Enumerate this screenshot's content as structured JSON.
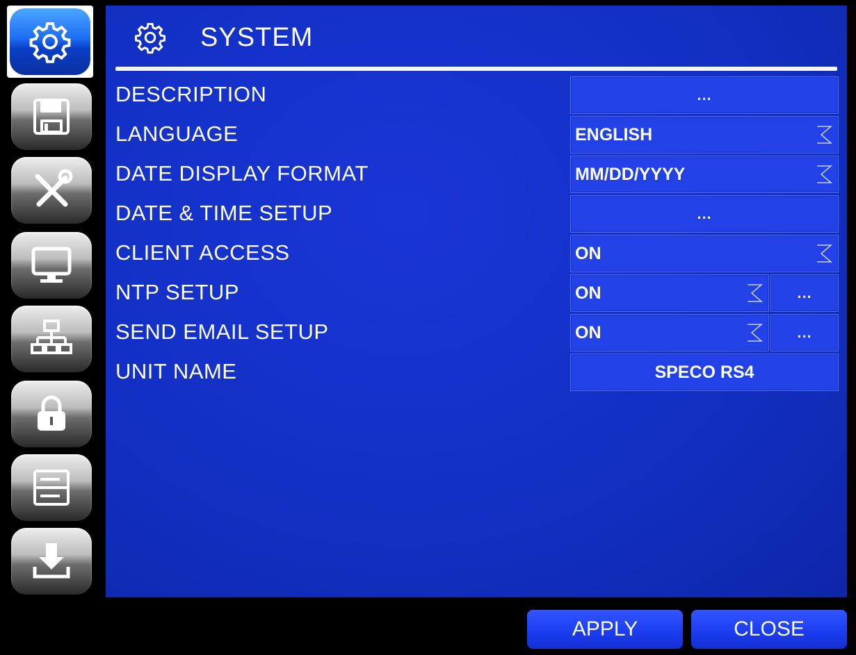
{
  "sidebar": {
    "items": [
      {
        "icon": "gear-icon",
        "active": true
      },
      {
        "icon": "floppy-disk-icon"
      },
      {
        "icon": "tools-icon"
      },
      {
        "icon": "monitor-icon"
      },
      {
        "icon": "network-icon"
      },
      {
        "icon": "lock-icon"
      },
      {
        "icon": "storage-icon"
      },
      {
        "icon": "download-icon"
      }
    ]
  },
  "header": {
    "icon": "gear-icon",
    "title": "SYSTEM"
  },
  "settings": [
    {
      "label": "DESCRIPTION",
      "value": "...",
      "type": "button"
    },
    {
      "label": "LANGUAGE",
      "value": "ENGLISH",
      "type": "dropdown"
    },
    {
      "label": "DATE DISPLAY FORMAT",
      "value": "MM/DD/YYYY",
      "type": "dropdown"
    },
    {
      "label": "DATE & TIME SETUP",
      "value": "...",
      "type": "button"
    },
    {
      "label": "CLIENT ACCESS",
      "value": "ON",
      "type": "dropdown"
    },
    {
      "label": "NTP SETUP",
      "value": "ON",
      "more": "...",
      "type": "dropdown-more"
    },
    {
      "label": "SEND EMAIL SETUP",
      "value": "ON",
      "more": "...",
      "type": "dropdown-more"
    },
    {
      "label": "UNIT NAME",
      "value": "SPECO RS4",
      "type": "text"
    }
  ],
  "footer": {
    "apply_label": "APPLY",
    "close_label": "CLOSE"
  },
  "colors": {
    "panel": "#1230c4",
    "field": "#2242e8",
    "button": "#1a3cf0",
    "active_icon": "#1e6df2"
  }
}
